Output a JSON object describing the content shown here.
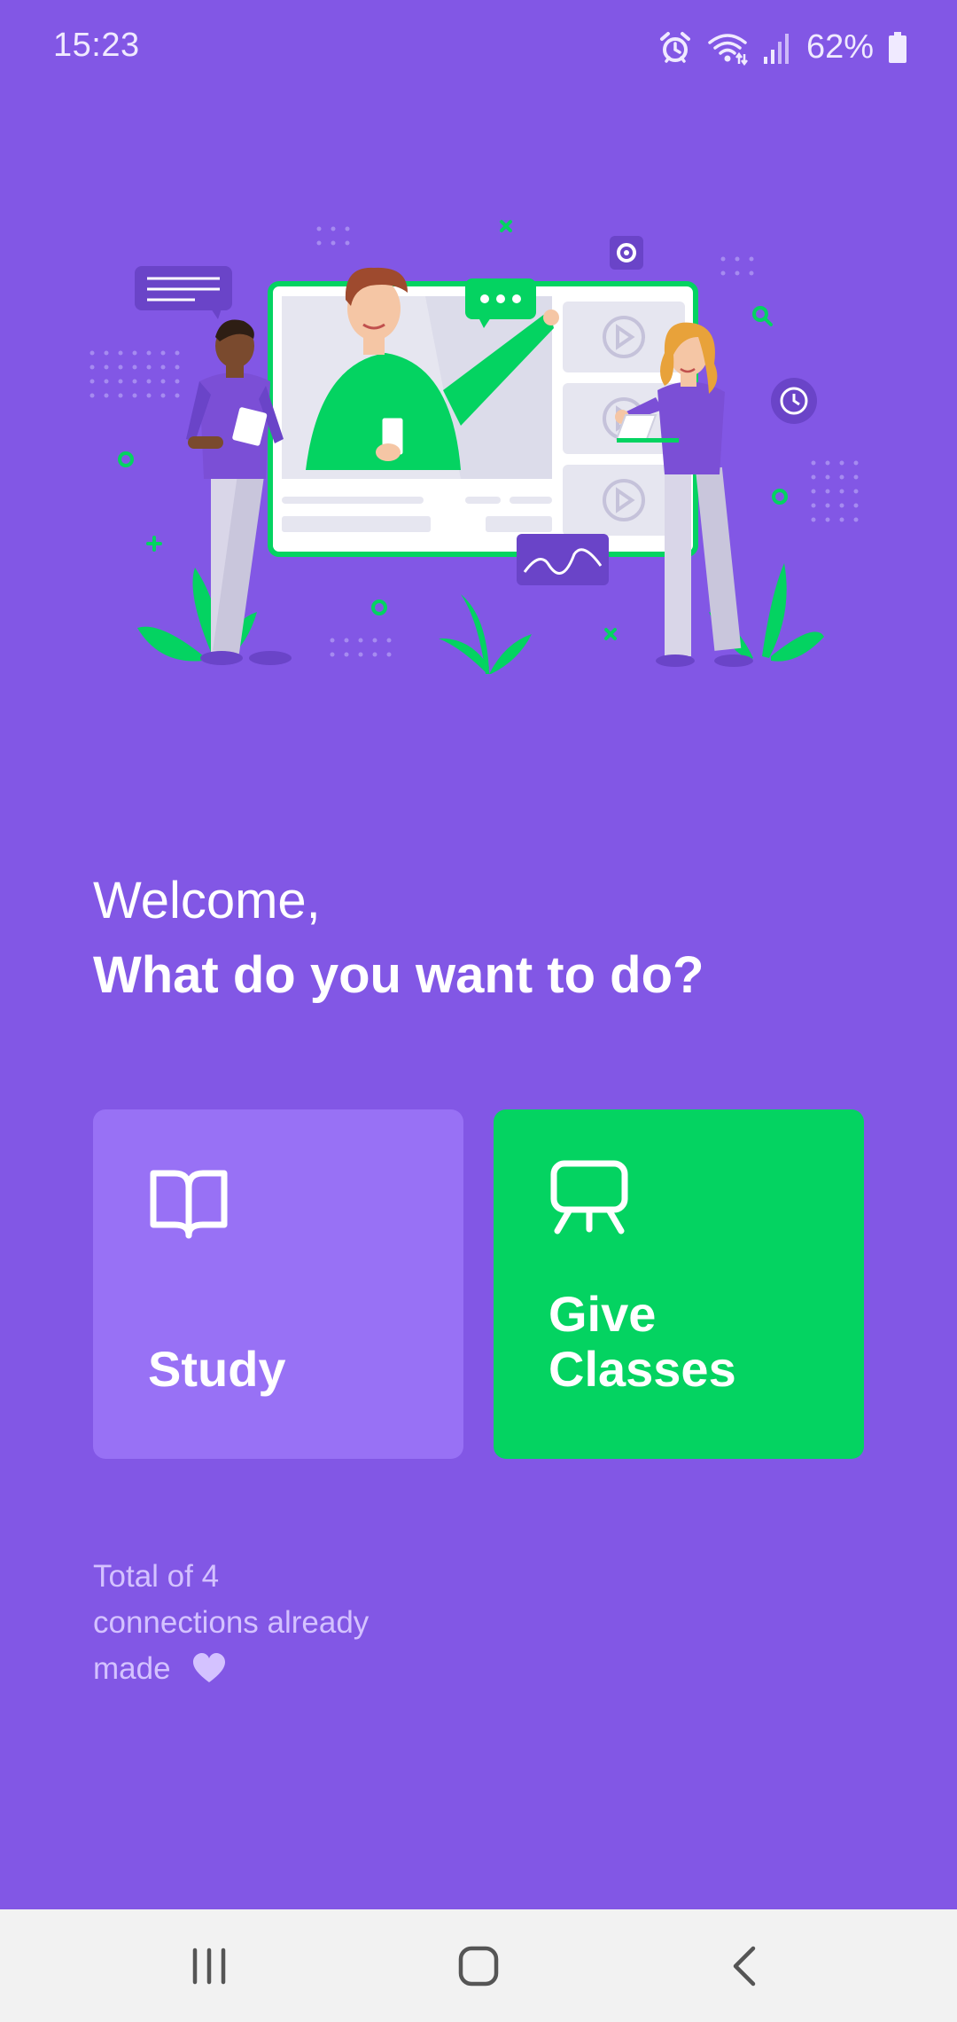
{
  "status_bar": {
    "time": "15:23",
    "battery": "62%",
    "icons": [
      "alarm-icon",
      "wifi-icon",
      "signal-icon",
      "battery-icon"
    ]
  },
  "welcome": {
    "greeting": "Welcome,",
    "question": "What do you want to do?"
  },
  "actions": {
    "study": {
      "label": "Study",
      "icon": "book-open-icon"
    },
    "give_classes": {
      "label_line1": "Give",
      "label_line2": "Classes",
      "icon": "presentation-board-icon"
    }
  },
  "connections": {
    "line1": "Total of 4",
    "line2": "connections already",
    "line3": "made",
    "icon": "heart-icon"
  },
  "nav": {
    "icons": [
      "recents-icon",
      "home-icon",
      "back-icon"
    ]
  },
  "colors": {
    "background": "#8257E5",
    "study_card": "#9871F5",
    "give_card": "#04D361",
    "secondary_text": "#D4C2FF",
    "nav_bar": "#F2F2F2"
  }
}
